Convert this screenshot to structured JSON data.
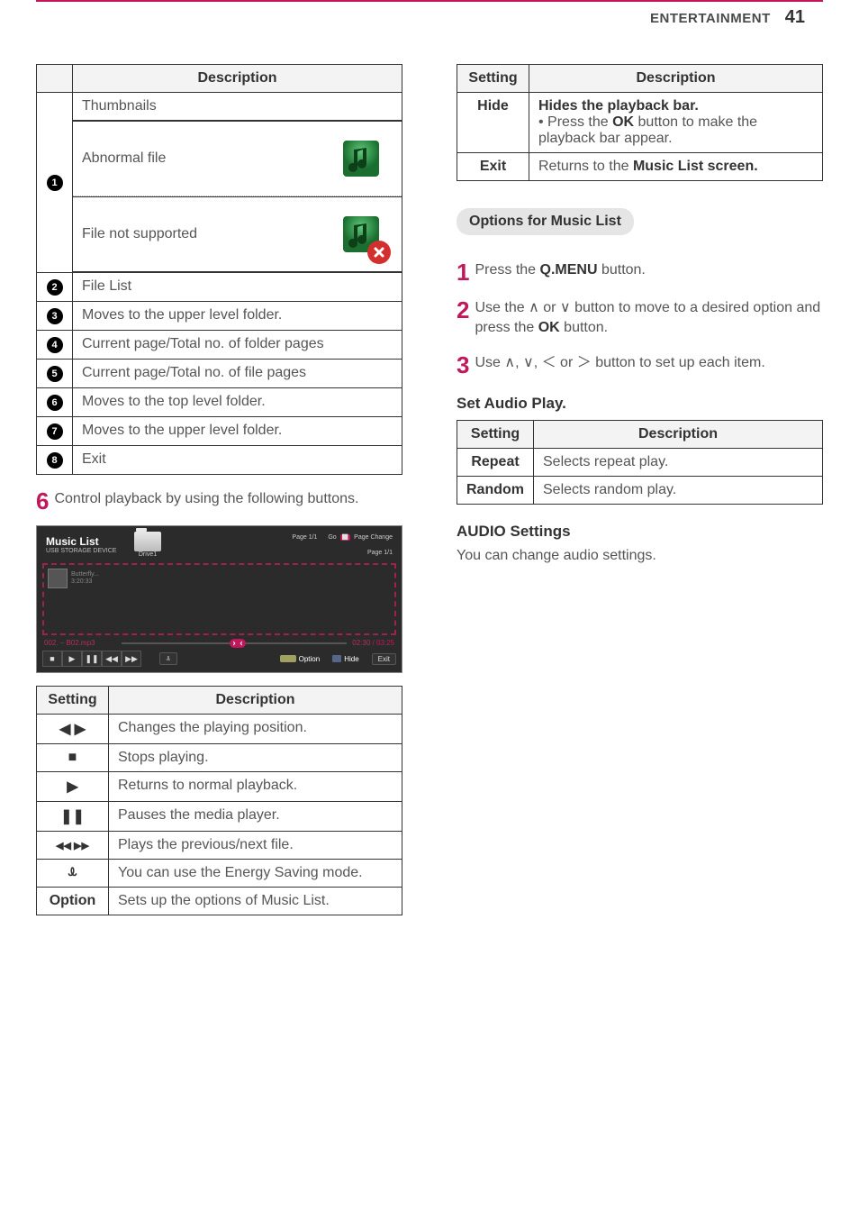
{
  "header": {
    "section": "ENTERTAINMENT",
    "page": "41"
  },
  "table1": {
    "head_desc": "Description",
    "rows": {
      "r1_num": "1",
      "r1_text": "Thumbnails",
      "r1a_text": "Abnormal file",
      "r1b_text": "File not supported",
      "r2_num": "2",
      "r2_text": "File List",
      "r3_num": "3",
      "r3_text": "Moves to the upper level folder.",
      "r4_num": "4",
      "r4_text": "Current page/Total no. of folder pages",
      "r5_num": "5",
      "r5_text": "Current page/Total no. of file pages",
      "r6_num": "6",
      "r6_text": "Moves to the top level folder.",
      "r7_num": "7",
      "r7_text": "Moves to the upper level folder.",
      "r8_num": "8",
      "r8_text": "Exit"
    }
  },
  "step6": {
    "num": "6",
    "text": "Control playback by using the following buttons."
  },
  "screenshot": {
    "title": "Music List",
    "subtitle": "USB STORAGE DEVICE",
    "drive": "Drive1",
    "page_top": "Page 1/1",
    "go": "Go",
    "page_change": "Page Change",
    "page_right": "Page 1/1",
    "item_title": "Butterfly...",
    "item_sub": "3:20:33",
    "track": "002. – B02.mp3",
    "time_cur": "02:30",
    "time_total": "/ 03:25",
    "option": "Option",
    "hide": "Hide",
    "exit": "Exit"
  },
  "table2": {
    "head_setting": "Setting",
    "head_desc": "Description",
    "r1_icon": "◀ ▶",
    "r1_text": "Changes the playing position.",
    "r2_icon": "■",
    "r2_text": "Stops playing.",
    "r3_icon": "▶",
    "r3_text": "Returns to normal playback.",
    "r4_icon": "❚❚",
    "r4_text": "Pauses the media player.",
    "r5_icon": "◀◀ ▶▶",
    "r5_text": "Plays the previous/next file.",
    "r6_icon": "ꕊ",
    "r6_text": "You can use the Energy Saving mode.",
    "r7_icon": "Option",
    "r7_text": "Sets up the options of Music List."
  },
  "table3": {
    "head_setting": "Setting",
    "head_desc": "Description",
    "r1_label": "Hide",
    "r1_bold": "Hides the playback bar.",
    "r1_bullet_pre": "Press the ",
    "r1_bullet_bold": "OK",
    "r1_bullet_post": " button to make the playback bar appear.",
    "r2_label": "Exit",
    "r2_pre": "Returns to the ",
    "r2_bold": "Music List screen."
  },
  "options": {
    "title": "Options for Music List",
    "s1_num": "1",
    "s1_pre": "Press the ",
    "s1_bold": "Q.MENU",
    "s1_post": " button.",
    "s2_num": "2",
    "s2_pre": "Use the ",
    "s2_mid": " or ",
    "s2_post1": " button to move to a desired option and press the ",
    "s2_bold": "OK",
    "s2_post2": " button.",
    "s3_num": "3",
    "s3_pre": "Use ",
    "s3_post": " button to set up each item."
  },
  "setaudio": {
    "title": "Set Audio Play.",
    "head_setting": "Setting",
    "head_desc": "Description",
    "r1_label": "Repeat",
    "r1_text": "Selects repeat play.",
    "r2_label": "Random",
    "r2_text": "Selects random play."
  },
  "audio": {
    "title": "AUDIO Settings",
    "text": "You can change audio settings."
  }
}
